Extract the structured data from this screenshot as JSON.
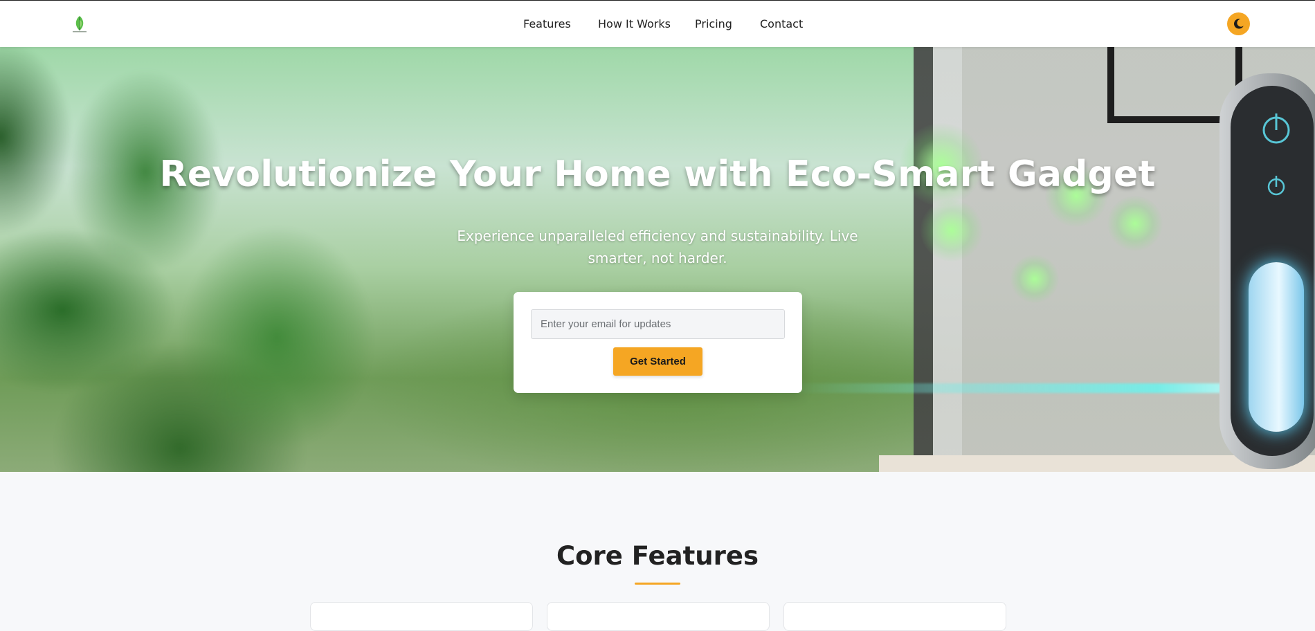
{
  "header": {
    "logo_icon": "leaf-logo-icon",
    "nav": [
      {
        "label": "Features"
      },
      {
        "label": "How It Works"
      },
      {
        "label": "Pricing"
      },
      {
        "label": "Contact"
      }
    ],
    "theme_toggle_icon": "moon-icon"
  },
  "hero": {
    "title": "Revolutionize Your Home with Eco-Smart Gadget",
    "subtitle": "Experience unparalleled efficiency and sustainability. Live smarter, not harder.",
    "email_placeholder": "Enter your email for updates",
    "email_value": "",
    "cta_label": "Get Started"
  },
  "features": {
    "title": "Core Features"
  },
  "colors": {
    "accent": "#f5a623",
    "text_dark": "#222222",
    "section_bg": "#f7f8fa",
    "header_bg": "#ffffff"
  }
}
